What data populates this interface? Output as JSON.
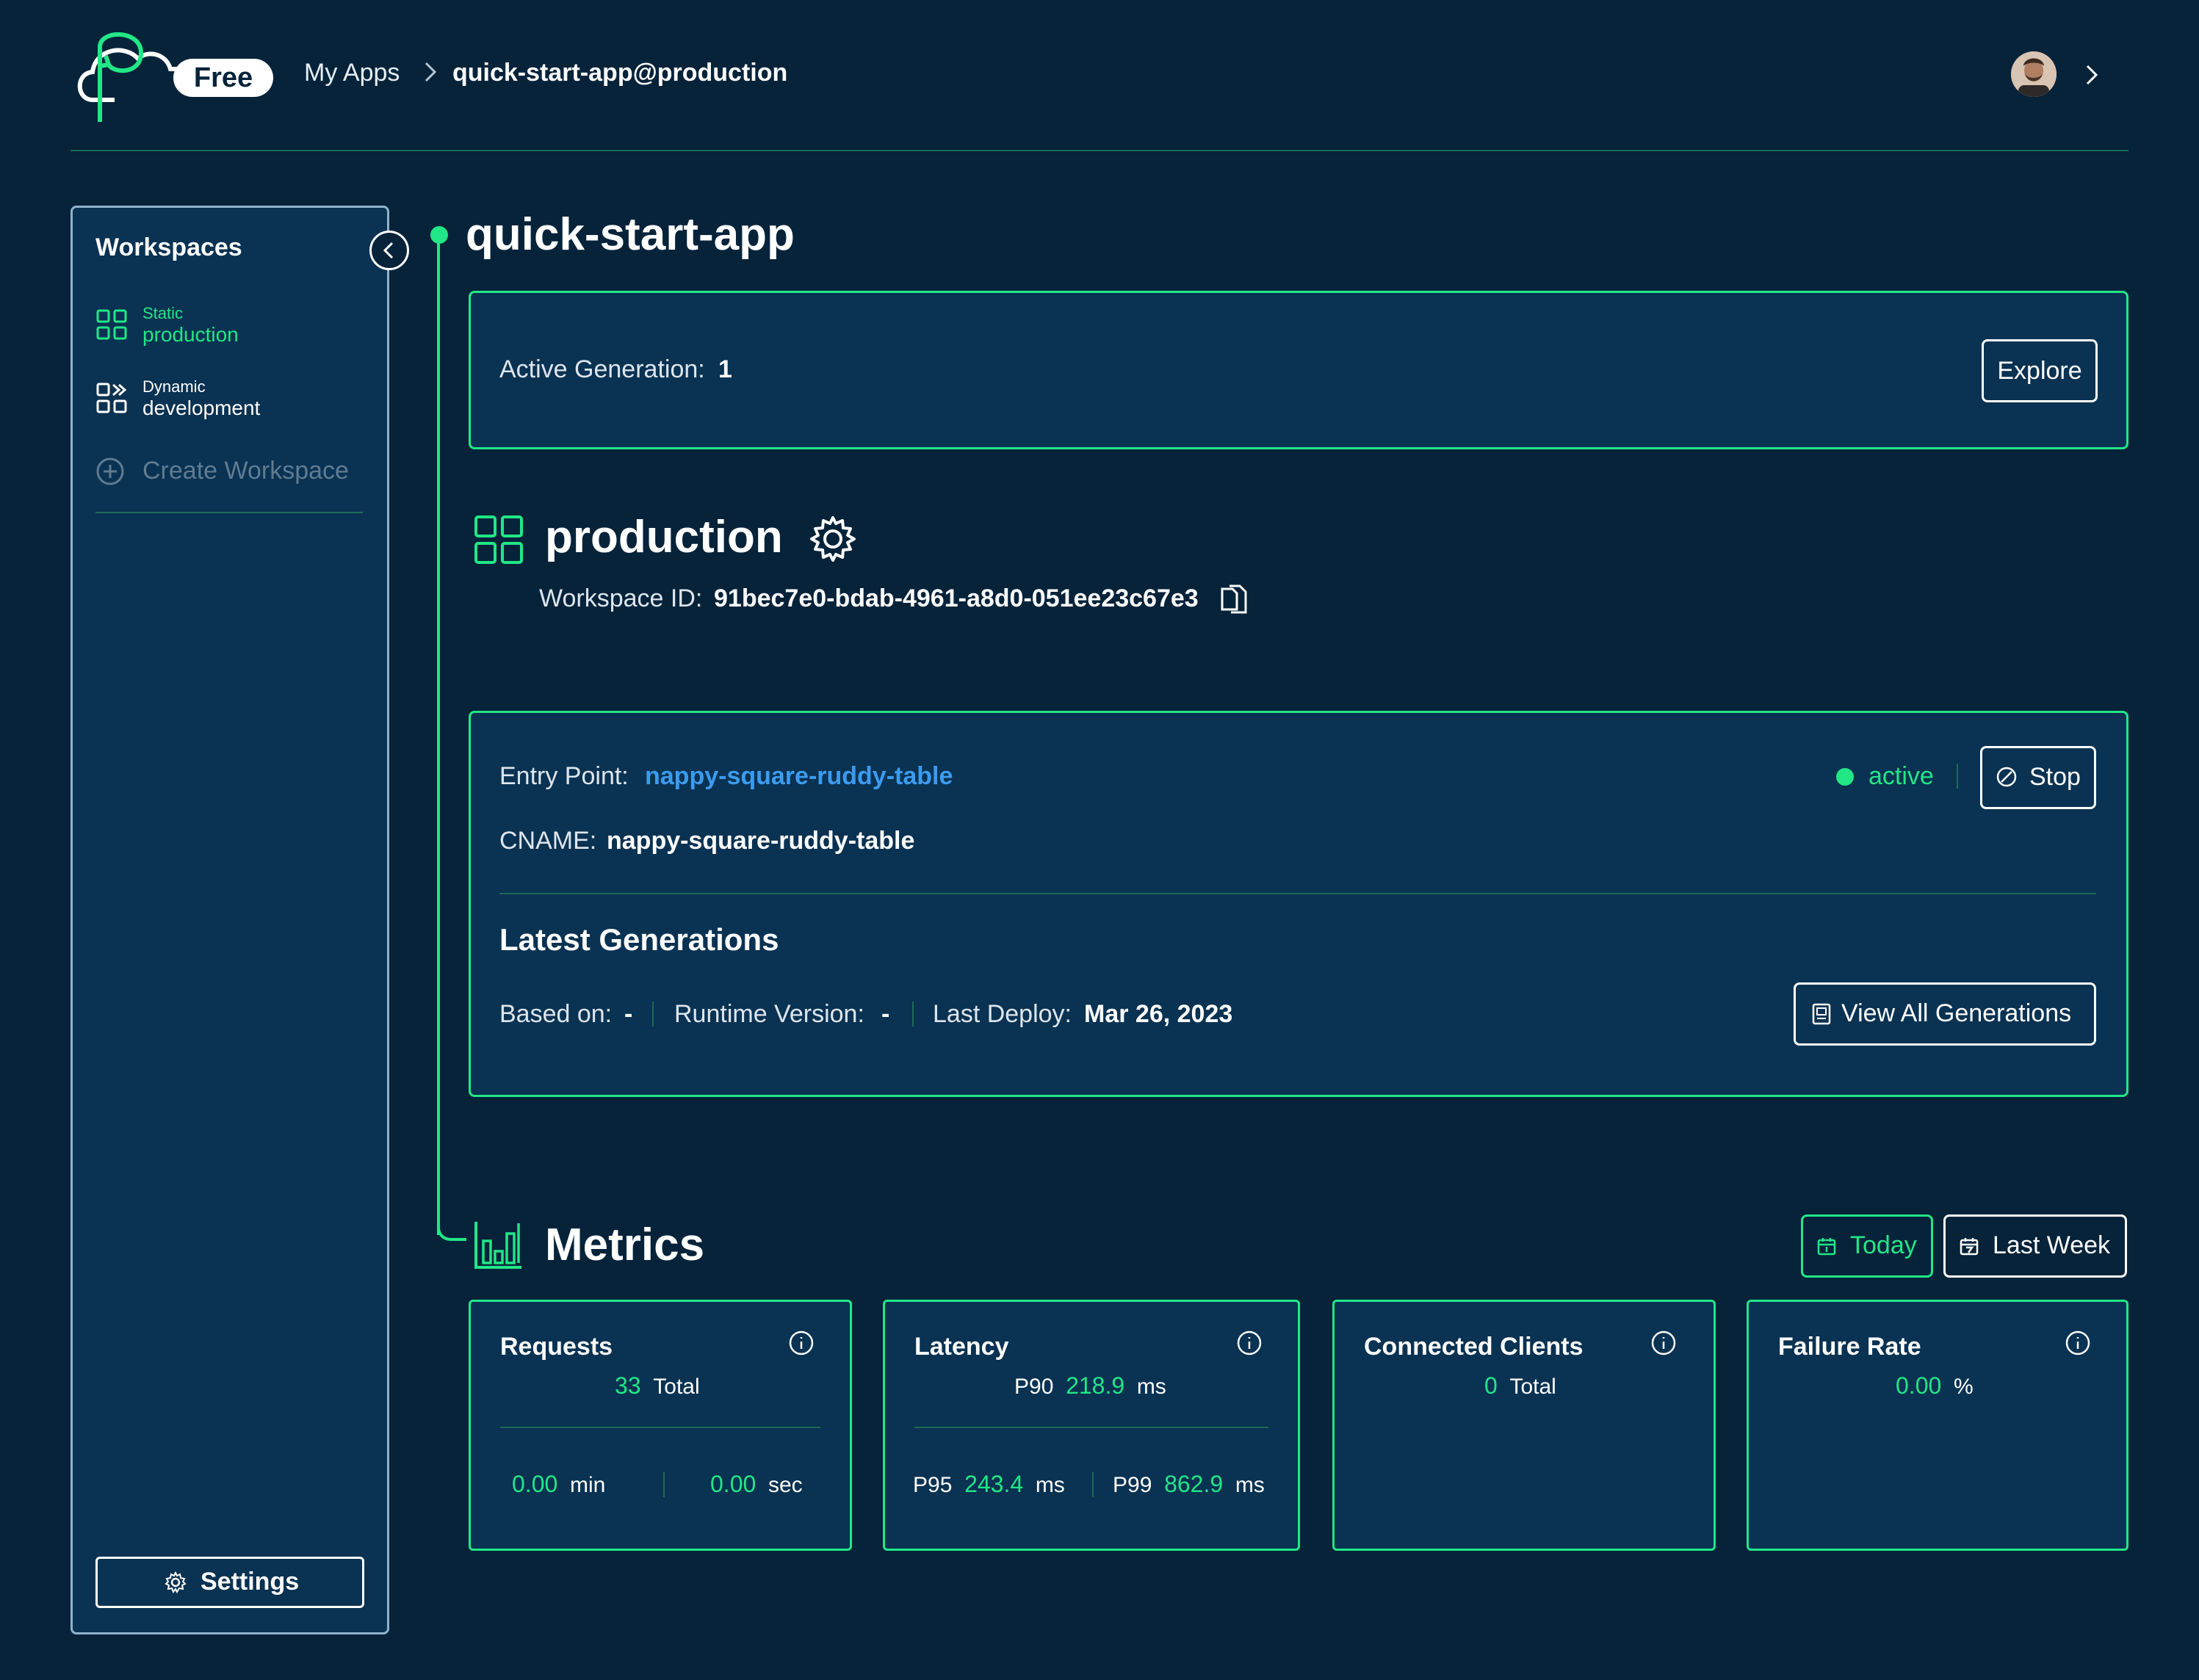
{
  "header": {
    "plan_badge": "Free",
    "breadcrumb": {
      "root": "My Apps",
      "current": "quick-start-app@production"
    }
  },
  "sidebar": {
    "title": "Workspaces",
    "items": [
      {
        "type": "Static",
        "name": "production",
        "active": true,
        "icon": "grid-icon"
      },
      {
        "type": "Dynamic",
        "name": "development",
        "active": false,
        "icon": "grid-forward-icon"
      }
    ],
    "create_label": "Create Workspace",
    "settings_label": "Settings"
  },
  "app": {
    "title": "quick-start-app",
    "active_generation_label": "Active Generation:",
    "active_generation_value": "1",
    "explore_label": "Explore"
  },
  "workspace": {
    "name": "production",
    "id_label": "Workspace ID:",
    "id_value": "91bec7e0-bdab-4961-a8d0-051ee23c67e3"
  },
  "entry": {
    "entry_point_label": "Entry Point:",
    "entry_point_value": "nappy-square-ruddy-table",
    "status": "active",
    "stop_label": "Stop",
    "cname_label": "CNAME:",
    "cname_value": "nappy-square-ruddy-table",
    "latest_generations_title": "Latest Generations",
    "based_on_label": "Based on:",
    "based_on_value": "-",
    "runtime_label": "Runtime Version:",
    "runtime_value": "-",
    "last_deploy_label": "Last Deploy:",
    "last_deploy_value": "Mar 26, 2023",
    "view_all_label": "View All Generations"
  },
  "metrics": {
    "title": "Metrics",
    "today_label": "Today",
    "last_week_label": "Last Week",
    "requests": {
      "title": "Requests",
      "total": "33",
      "total_unit": "Total",
      "per_min": "0.00",
      "per_min_unit": "min",
      "per_sec": "0.00",
      "per_sec_unit": "sec"
    },
    "latency": {
      "title": "Latency",
      "p90_label": "P90",
      "p90": "218.9",
      "p90_unit": "ms",
      "p95_label": "P95",
      "p95": "243.4",
      "p95_unit": "ms",
      "p99_label": "P99",
      "p99": "862.9",
      "p99_unit": "ms"
    },
    "connected_clients": {
      "title": "Connected Clients",
      "total": "0",
      "total_unit": "Total"
    },
    "failure_rate": {
      "title": "Failure Rate",
      "value": "0.00",
      "unit": "%"
    }
  },
  "colors": {
    "background": "#06233A",
    "card": "#0A3252",
    "accent": "#21E786",
    "link": "#3C9BEE"
  }
}
